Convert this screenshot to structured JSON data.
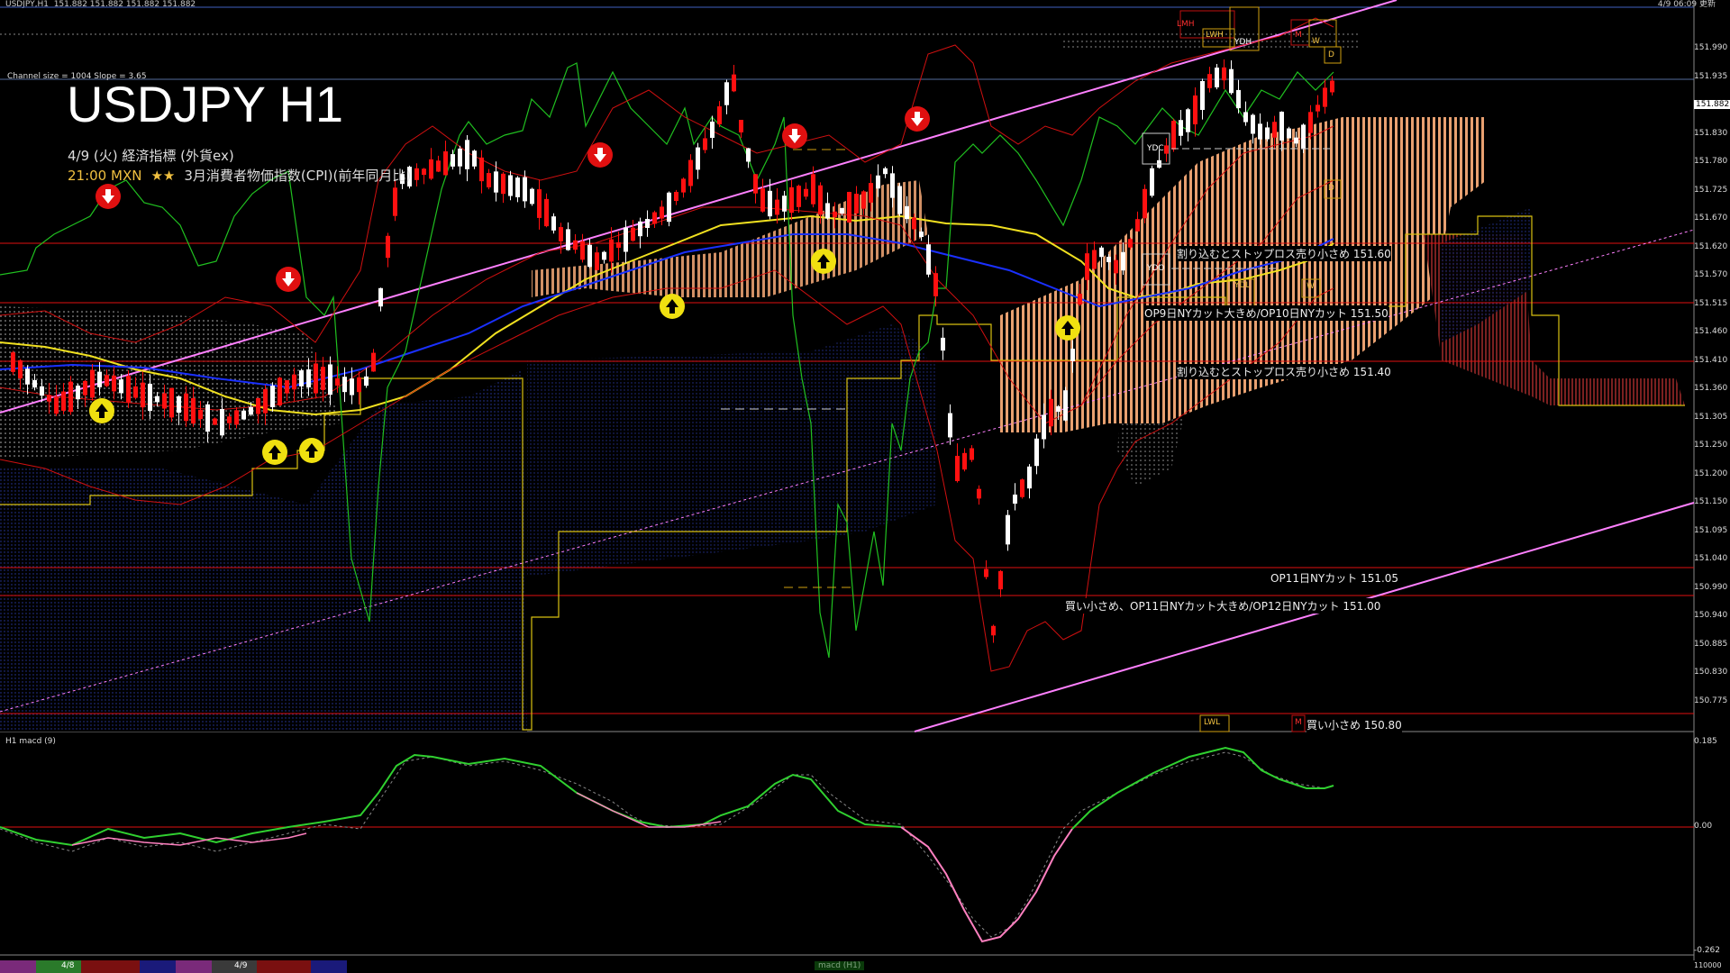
{
  "window": {
    "title": "USDJPY,H1",
    "quote": "151.882 151.882 151.882 151.882",
    "top_right": "4/9 06:09 更新"
  },
  "chart": {
    "symbol_title": "USDJPY H1",
    "channel_info": "Channel size = 1004 Slope = 3.65",
    "indicator_header": "4/9 (火) 経済指標 (外貨ex)",
    "event": {
      "time": "21:00 MXN",
      "stars": "★★",
      "text": "3月消費者物価指数(CPI)(前年同月比)"
    },
    "levels": [
      {
        "label": "割り込むとストップロス売り小さめ 151.60"
      },
      {
        "label": "OP9日NYカット大きめ/OP10日NYカット 151.50"
      },
      {
        "label": "割り込むとストップロス売り小さめ 151.40"
      },
      {
        "label": "OP11日NYカット 151.05"
      },
      {
        "label": "買い小さめ、OP11日NYカット大きめ/OP12日NYカット 151.00"
      },
      {
        "label": "買い小さめ 150.80"
      }
    ],
    "boxes": {
      "lmh": "LMH",
      "lwh": "LWH",
      "ydh": "YDH",
      "m": "M",
      "w": "W",
      "d": "D",
      "d2": "D",
      "ydc": "YDC",
      "ydo": "YDO",
      "ydl": "YDL",
      "w2": "W",
      "lwl": "LWL",
      "m2": "M"
    },
    "price_axis": [
      "151.990",
      "151.935",
      "151.882",
      "151.830",
      "151.780",
      "151.725",
      "151.670",
      "151.620",
      "151.570",
      "151.515",
      "151.460",
      "151.410",
      "151.360",
      "151.305",
      "151.250",
      "151.200",
      "151.150",
      "151.095",
      "151.040",
      "150.990",
      "150.940",
      "150.885",
      "150.830",
      "150.775"
    ]
  },
  "macd": {
    "title": "H1  macd (9)",
    "axis": [
      "0.185",
      "0.00",
      "-0.262"
    ],
    "bottom_right": "110000"
  },
  "bottom": {
    "dates": [
      "4/8",
      "4/9"
    ],
    "tab": "macd (H1)"
  },
  "colors": {
    "red_line": "#e01010",
    "magenta": "#ff80ff",
    "green": "#20c020",
    "yellow": "#f0e020",
    "blue": "#1a30ff",
    "bull": "#ffffff",
    "bear": "#ff1010"
  }
}
